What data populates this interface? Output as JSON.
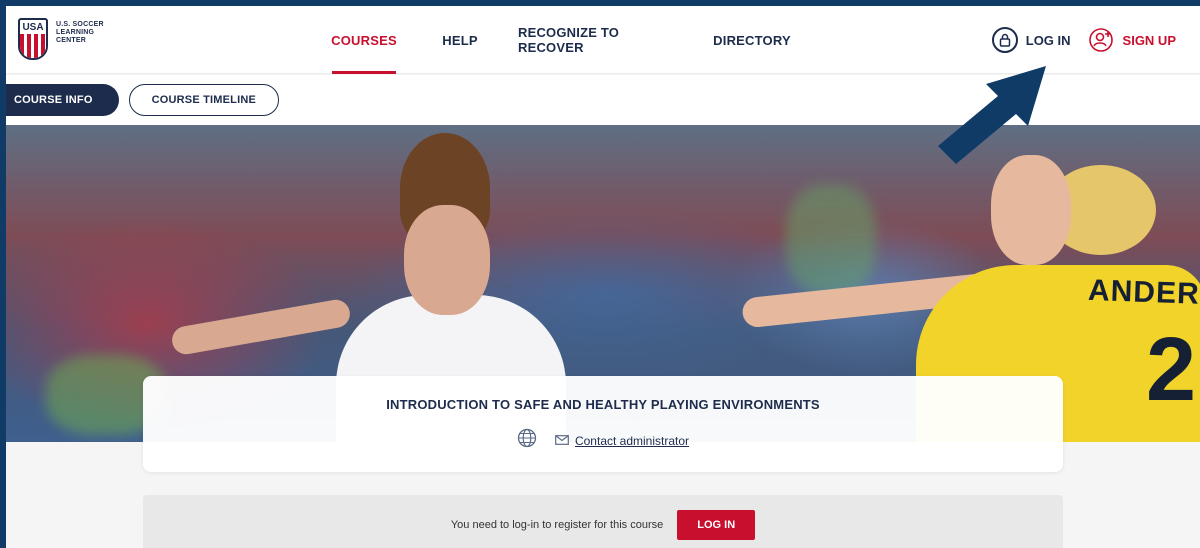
{
  "logo": {
    "crest_text": "USA",
    "lines": [
      "U.S. SOCCER",
      "LEARNING",
      "CENTER"
    ]
  },
  "nav": {
    "items": [
      {
        "label": "COURSES",
        "active": true
      },
      {
        "label": "HELP",
        "active": false
      },
      {
        "label": "RECOGNIZE TO RECOVER",
        "active": false
      },
      {
        "label": "DIRECTORY",
        "active": false
      }
    ]
  },
  "auth": {
    "login_label": "LOG IN",
    "signup_label": "SIGN UP",
    "login_icon": "lock-icon",
    "signup_icon": "user-add-icon"
  },
  "subnav": {
    "tabs": [
      {
        "label": "COURSE INFO",
        "active": true
      },
      {
        "label": "COURSE TIMELINE",
        "active": false
      }
    ]
  },
  "hero": {
    "jersey_name": "ANDERSSO",
    "jersey_number": "2"
  },
  "course": {
    "title": "INTRODUCTION TO SAFE AND HEALTHY PLAYING ENVIRONMENTS",
    "contact_label": "Contact administrator",
    "language_icon": "globe-icon"
  },
  "register": {
    "message": "You need to log-in to register for this course",
    "button_label": "LOG IN"
  },
  "colors": {
    "navy": "#1d2c4c",
    "red": "#c8102e",
    "frame": "#0f3b66",
    "arrow": "#0f3b66"
  }
}
